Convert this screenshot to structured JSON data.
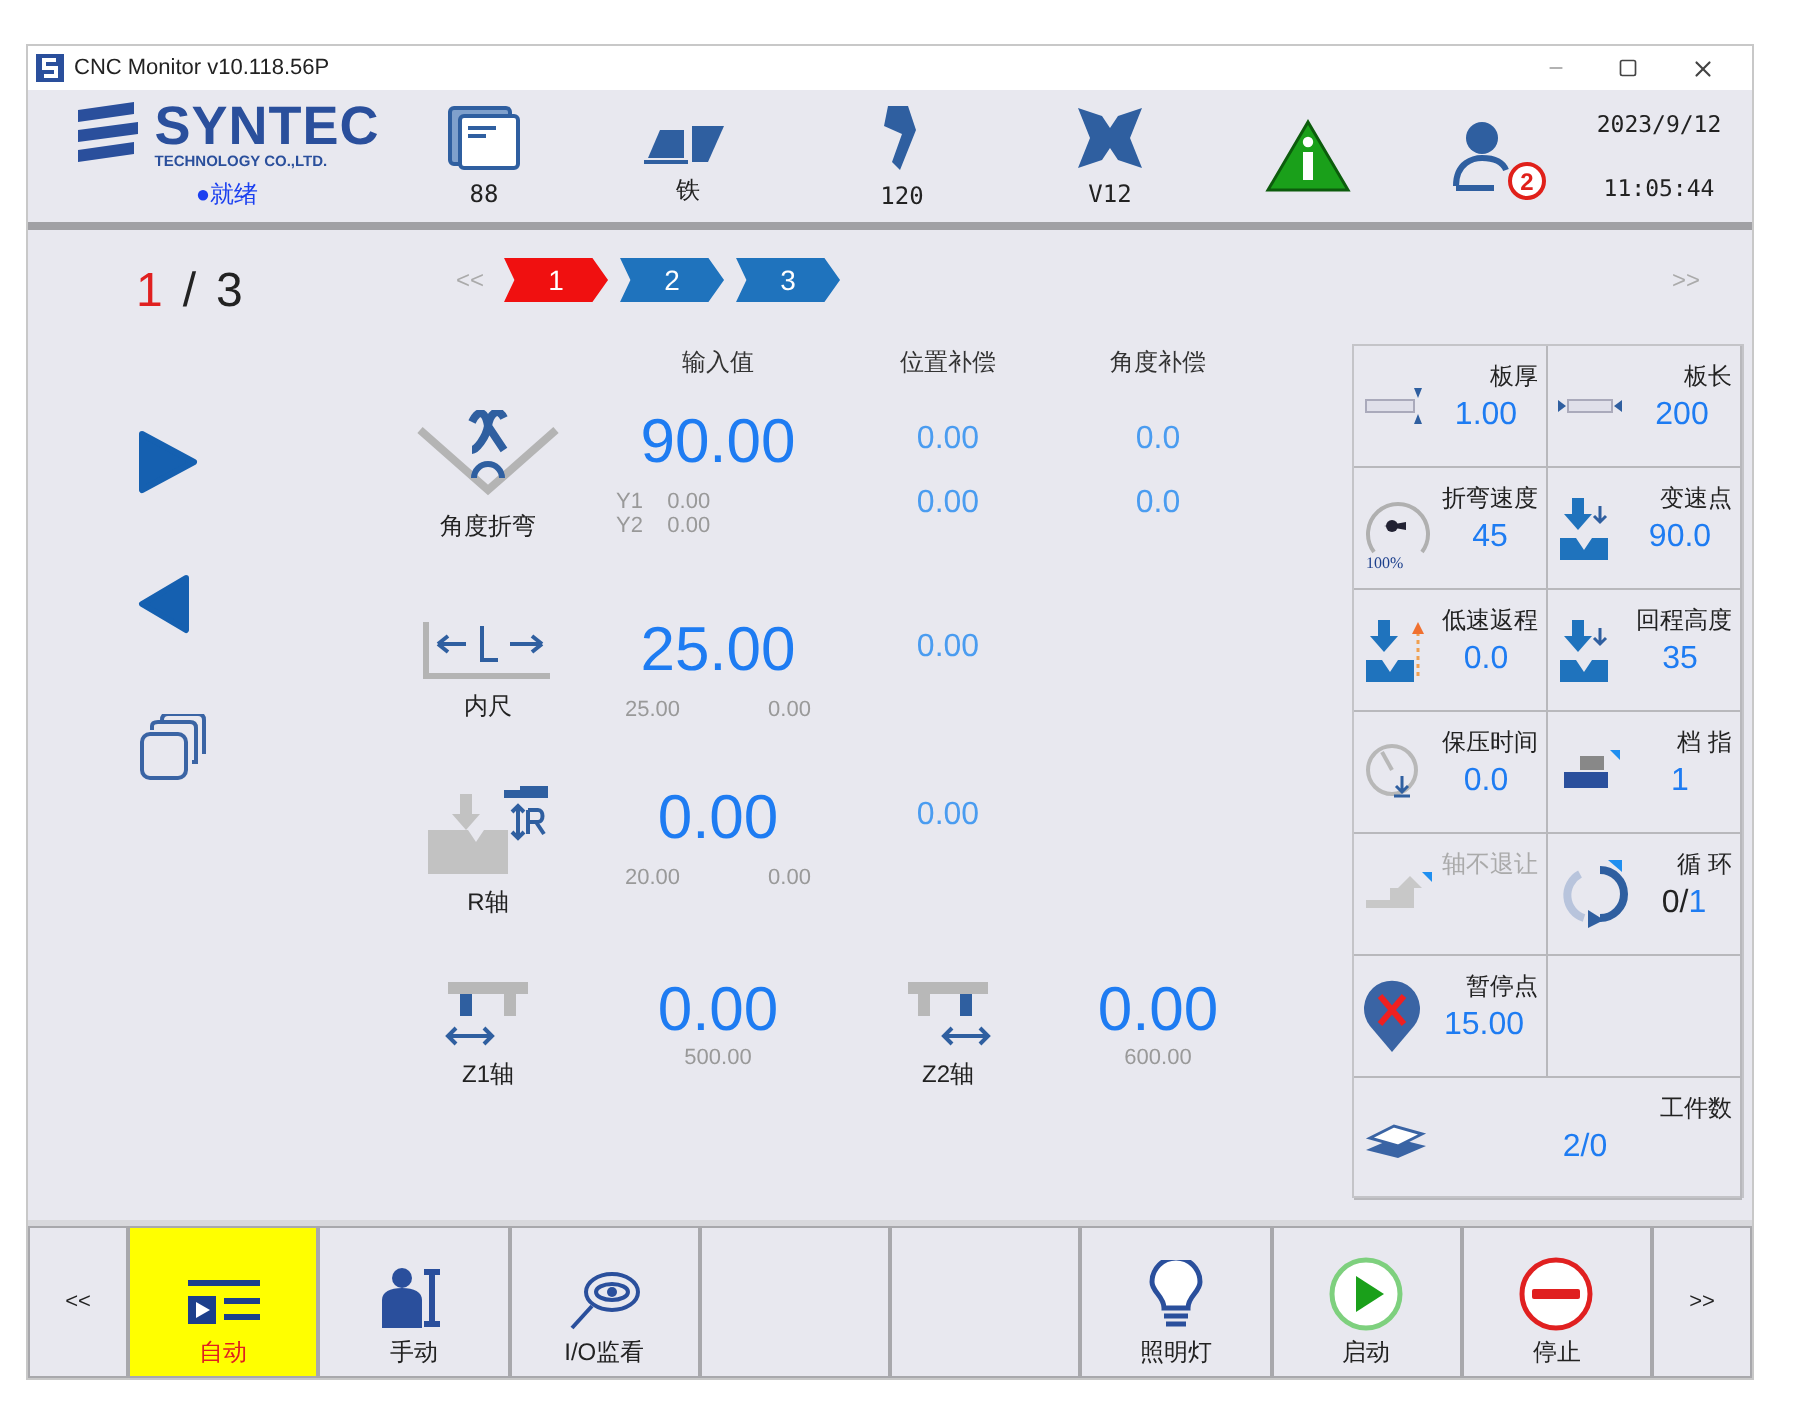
{
  "window": {
    "title": "CNC Monitor v10.118.56P"
  },
  "header": {
    "logo": {
      "name": "SYNTEC",
      "subtitle": "TECHNOLOGY CO.,LTD."
    },
    "status": "●就绪",
    "items": [
      {
        "kind": "program",
        "label": "88"
      },
      {
        "kind": "mold",
        "label": "铁"
      },
      {
        "kind": "punch",
        "label": "120"
      },
      {
        "kind": "die",
        "label": "V12"
      },
      {
        "kind": "warning"
      },
      {
        "kind": "user",
        "badge": "2"
      }
    ],
    "date": "2023/9/12",
    "time": "11:05:44"
  },
  "pager": {
    "current": "1",
    "separator": "/",
    "total": "3",
    "prev": "<<",
    "next": ">>",
    "steps": [
      {
        "label": "1",
        "selected": true
      },
      {
        "label": "2",
        "selected": false
      },
      {
        "label": "3",
        "selected": false
      }
    ]
  },
  "columns": [
    "输入值",
    "位置补偿",
    "角度补偿"
  ],
  "rows": [
    {
      "kind": "angle",
      "label": "角度折弯",
      "value": "90.00",
      "readings": [
        {
          "name": "Y1",
          "value": "0.00"
        },
        {
          "name": "Y2",
          "value": "0.00"
        }
      ],
      "position_comp": [
        "0.00",
        "0.00"
      ],
      "angle_comp": [
        "0.0",
        "0.0"
      ]
    },
    {
      "kind": "inner",
      "label": "内尺",
      "value": "25.00",
      "readings": [
        {
          "value": "25.00"
        },
        {
          "value": "0.00"
        }
      ],
      "position_comp": [
        "0.00"
      ]
    },
    {
      "kind": "r_axis",
      "label": "R轴",
      "value": "0.00",
      "readings": [
        {
          "value": "20.00"
        },
        {
          "value": "0.00"
        }
      ],
      "position_comp": [
        "0.00"
      ]
    }
  ],
  "z_axes": [
    {
      "label": "Z1轴",
      "value": "0.00",
      "reading": "500.00"
    },
    {
      "label": "Z2轴",
      "value": "0.00",
      "reading": "600.00"
    }
  ],
  "tiles": [
    {
      "kind": "thickness",
      "label": "板厚",
      "value": "1.00"
    },
    {
      "kind": "length",
      "label": "板长",
      "value": "200"
    },
    {
      "kind": "speed",
      "label": "折弯速度",
      "value": "45",
      "gauge": "100%"
    },
    {
      "kind": "speed_change",
      "label": "变速点",
      "value": "90.0"
    },
    {
      "kind": "slow_return",
      "label": "低速返程",
      "value": "0.0"
    },
    {
      "kind": "return_height",
      "label": "回程高度",
      "value": "35"
    },
    {
      "kind": "hold_time",
      "label": "保压时间",
      "value": "0.0"
    },
    {
      "kind": "finger",
      "label": "档 指",
      "value": "1"
    },
    {
      "kind": "no_retract",
      "label": "轴不退让",
      "disabled": true
    },
    {
      "kind": "cycle",
      "label": "循 环",
      "count": "0/",
      "total": "1"
    },
    {
      "kind": "pause",
      "label": "暂停点",
      "value": "15.00"
    },
    {
      "kind": "empty"
    },
    {
      "kind": "workpieces",
      "label": "工件数",
      "value": "2/0"
    }
  ],
  "buttons": [
    {
      "kind": "nav",
      "label": "<<"
    },
    {
      "kind": "auto",
      "label": "自动",
      "selected": true
    },
    {
      "kind": "manual",
      "label": "手动",
      "selected": false
    },
    {
      "kind": "io",
      "label": "I/O监看",
      "selected": false
    },
    {
      "kind": "blank",
      "selected": false
    },
    {
      "kind": "blank",
      "selected": false
    },
    {
      "kind": "light",
      "label": "照明灯",
      "selected": false
    },
    {
      "kind": "start",
      "label": "启动",
      "selected": false
    },
    {
      "kind": "stop",
      "label": "停止",
      "selected": false
    },
    {
      "kind": "nav",
      "label": ">>"
    }
  ]
}
